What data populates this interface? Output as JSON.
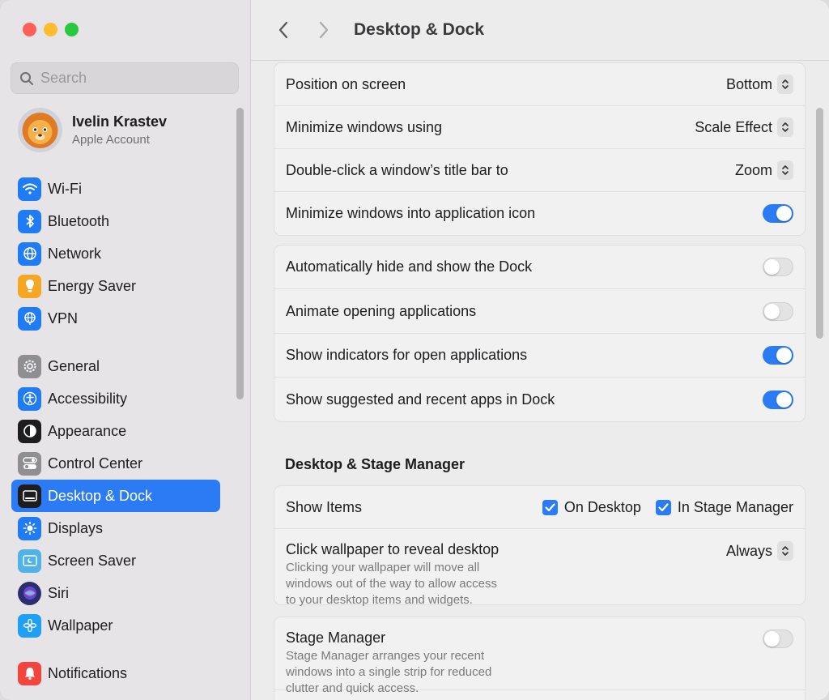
{
  "window": {
    "title": "Desktop & Dock"
  },
  "search": {
    "placeholder": "Search"
  },
  "account": {
    "name": "Ivelin Krastev",
    "subtitle": "Apple Account"
  },
  "sidebar": {
    "groups": [
      [
        {
          "label": "Wi-Fi",
          "icon": "wifi-icon",
          "color": "#1f7cf5"
        },
        {
          "label": "Bluetooth",
          "icon": "bluetooth-icon",
          "color": "#1f7cf5"
        },
        {
          "label": "Network",
          "icon": "globe-icon",
          "color": "#1f7cf5"
        },
        {
          "label": "Energy Saver",
          "icon": "lightbulb-icon",
          "color": "#f5a623"
        },
        {
          "label": "VPN",
          "icon": "vpn-globe-icon",
          "color": "#1f7cf5"
        }
      ],
      [
        {
          "label": "General",
          "icon": "gear-icon",
          "color": "#8e8e93"
        },
        {
          "label": "Accessibility",
          "icon": "accessibility-icon",
          "color": "#1f7cf5"
        },
        {
          "label": "Appearance",
          "icon": "appearance-icon",
          "color": "#1d1d1f"
        },
        {
          "label": "Control Center",
          "icon": "control-center-icon",
          "color": "#8e8e93"
        },
        {
          "label": "Desktop & Dock",
          "icon": "dock-icon",
          "color": "#1d1d1f",
          "active": true
        },
        {
          "label": "Displays",
          "icon": "sun-icon",
          "color": "#1f7cf5"
        },
        {
          "label": "Screen Saver",
          "icon": "screen-saver-icon",
          "color": "#4fb3e8"
        },
        {
          "label": "Siri",
          "icon": "siri-icon",
          "color": "#2d2d6e"
        },
        {
          "label": "Wallpaper",
          "icon": "flower-icon",
          "color": "#1f9ff5"
        }
      ],
      [
        {
          "label": "Notifications",
          "icon": "bell-icon",
          "color": "#f2453d"
        }
      ]
    ]
  },
  "dock_panel": {
    "rows": [
      {
        "label": "Position on screen",
        "value": "Bottom"
      },
      {
        "label": "Minimize windows using",
        "value": "Scale Effect"
      },
      {
        "label": "Double-click a window’s title bar to",
        "value": "Zoom"
      },
      {
        "label": "Minimize windows into application icon",
        "toggle": true
      }
    ]
  },
  "dock_toggles": {
    "rows": [
      {
        "label": "Automatically hide and show the Dock",
        "toggle": false
      },
      {
        "label": "Animate opening applications",
        "toggle": false
      },
      {
        "label": "Show indicators for open applications",
        "toggle": true
      },
      {
        "label": "Show suggested and recent apps in Dock",
        "toggle": true
      }
    ]
  },
  "stage_section": {
    "title": "Desktop & Stage Manager",
    "show_items": {
      "label": "Show Items",
      "on_desktop": "On Desktop",
      "in_stage_manager": "In Stage Manager"
    },
    "click_wallpaper": {
      "label": "Click wallpaper to reveal desktop",
      "value": "Always",
      "description": "Clicking your wallpaper will move all windows out of the way to allow access to your desktop items and widgets."
    },
    "stage_manager": {
      "label": "Stage Manager",
      "description": "Stage Manager arranges your recent windows into a single strip for reduced clutter and quick access.",
      "toggle": false
    }
  }
}
